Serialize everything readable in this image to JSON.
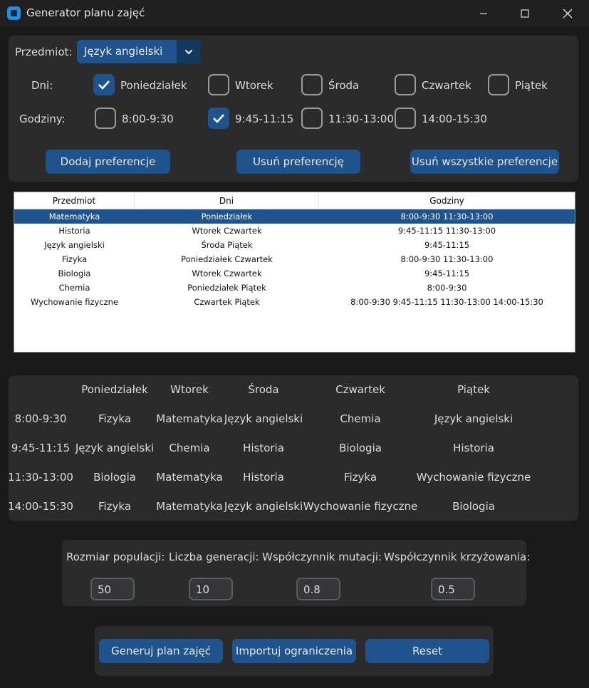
{
  "window": {
    "title": "Generator planu zajęć"
  },
  "subject": {
    "label": "Przedmiot:",
    "selected": "Język angielski"
  },
  "days": {
    "label": "Dni:",
    "options": [
      {
        "label": "Poniedziałek",
        "checked": true
      },
      {
        "label": "Wtorek",
        "checked": false
      },
      {
        "label": "Środa",
        "checked": false
      },
      {
        "label": "Czwartek",
        "checked": false
      },
      {
        "label": "Piątek",
        "checked": false
      }
    ]
  },
  "hours": {
    "label": "Godziny:",
    "options": [
      {
        "label": "8:00-9:30",
        "checked": false
      },
      {
        "label": "9:45-11:15",
        "checked": true
      },
      {
        "label": "11:30-13:00",
        "checked": false
      },
      {
        "label": "14:00-15:30",
        "checked": false
      }
    ]
  },
  "pref_buttons": {
    "add": "Dodaj preferencje",
    "remove": "Usuń preferencję",
    "remove_all": "Usuń wszystkie preferencje"
  },
  "preferences_table": {
    "columns": [
      "Przedmiot",
      "Dni",
      "Godziny"
    ],
    "rows": [
      [
        "Matematyka",
        "Poniedziałek",
        "8:00-9:30 11:30-13:00"
      ],
      [
        "Historia",
        "Wtorek Czwartek",
        "9:45-11:15 11:30-13:00"
      ],
      [
        "Język angielski",
        "Środa Piątek",
        "9:45-11:15"
      ],
      [
        "Fizyka",
        "Poniedziałek Czwartek",
        "8:00-9:30 11:30-13:00"
      ],
      [
        "Biologia",
        "Wtorek Czwartek",
        "9:45-11:15"
      ],
      [
        "Chemia",
        "Poniedziałek Piątek",
        "8:00-9:30"
      ],
      [
        "Wychowanie fizyczne",
        "Czwartek Piątek",
        "8:00-9:30 9:45-11:15 11:30-13:00 14:00-15:30"
      ]
    ],
    "selected_row": 0
  },
  "schedule": {
    "days": [
      "Poniedziałek",
      "Wtorek",
      "Środa",
      "Czwartek",
      "Piątek"
    ],
    "slots": [
      {
        "time": "8:00-9:30",
        "cells": [
          "Fizyka",
          "Matematyka",
          "Język angielski",
          "Chemia",
          "Język angielski"
        ]
      },
      {
        "time": "9:45-11:15",
        "cells": [
          "Język angielski",
          "Chemia",
          "Historia",
          "Biologia",
          "Historia"
        ]
      },
      {
        "time": "11:30-13:00",
        "cells": [
          "Biologia",
          "Matematyka",
          "Historia",
          "Fizyka",
          "Wychowanie fizyczne"
        ]
      },
      {
        "time": "14:00-15:30",
        "cells": [
          "Fizyka",
          "Matematyka",
          "Język angielski",
          "Wychowanie fizyczne",
          "Biologia"
        ]
      }
    ]
  },
  "params": {
    "population": {
      "label": "Rozmiar populacji:",
      "value": "50"
    },
    "generations": {
      "label": "Liczba generacji:",
      "value": "10"
    },
    "mutation": {
      "label": "Współczynnik mutacji:",
      "value": "0.8"
    },
    "crossover": {
      "label": "Współczynnik krzyżowania:",
      "value": "0.5"
    }
  },
  "actions": {
    "generate": "Generuj plan zajęć",
    "import": "Importuj ograniczenia",
    "reset": "Reset"
  },
  "colors": {
    "accent": "#1f538d",
    "panel": "#2b2b2b",
    "background": "#1a1a1a"
  }
}
